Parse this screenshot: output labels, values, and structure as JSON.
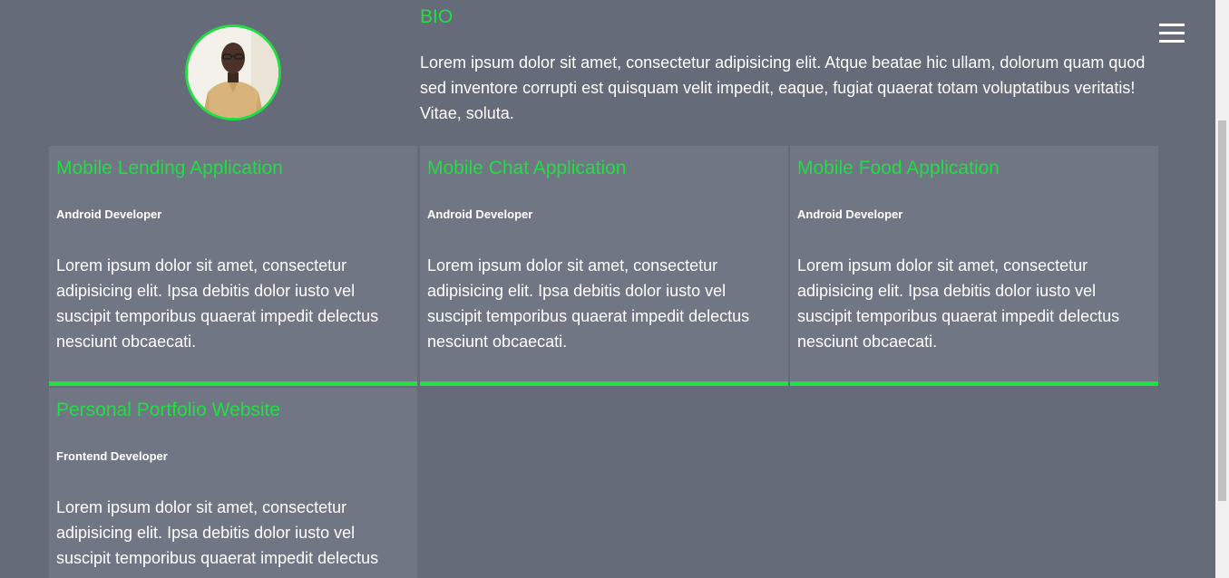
{
  "bio": {
    "heading": "BIO",
    "text": "Lorem ipsum dolor sit amet, consectetur adipisicing elit. Atque beatae hic ullam, dolorum quam quod sed inventore corrupti est quisquam velit impedit, eaque, fugiat quaerat totam voluptatibus veritatis! Vitae, soluta."
  },
  "colors": {
    "background": "#656b78",
    "card": "#707684",
    "accent": "#22dd44",
    "text": "#ffffff"
  },
  "icons": {
    "menu": "hamburger-menu-icon",
    "avatar": "profile-photo"
  },
  "projects": [
    {
      "title": "Mobile Lending Application",
      "role": "Android Developer",
      "description": "Lorem ipsum dolor sit amet, consectetur adipisicing elit. Ipsa debitis dolor iusto vel suscipit temporibus quaerat impedit delectus nesciunt obcaecati."
    },
    {
      "title": "Mobile Chat Application",
      "role": "Android Developer",
      "description": "Lorem ipsum dolor sit amet, consectetur adipisicing elit. Ipsa debitis dolor iusto vel suscipit temporibus quaerat impedit delectus nesciunt obcaecati."
    },
    {
      "title": "Mobile Food Application",
      "role": "Android Developer",
      "description": "Lorem ipsum dolor sit amet, consectetur adipisicing elit. Ipsa debitis dolor iusto vel suscipit temporibus quaerat impedit delectus nesciunt obcaecati."
    },
    {
      "title": "Personal Portfolio Website",
      "role": "Frontend Developer",
      "description": "Lorem ipsum dolor sit amet, consectetur adipisicing elit. Ipsa debitis dolor iusto vel suscipit temporibus quaerat impedit delectus"
    }
  ]
}
